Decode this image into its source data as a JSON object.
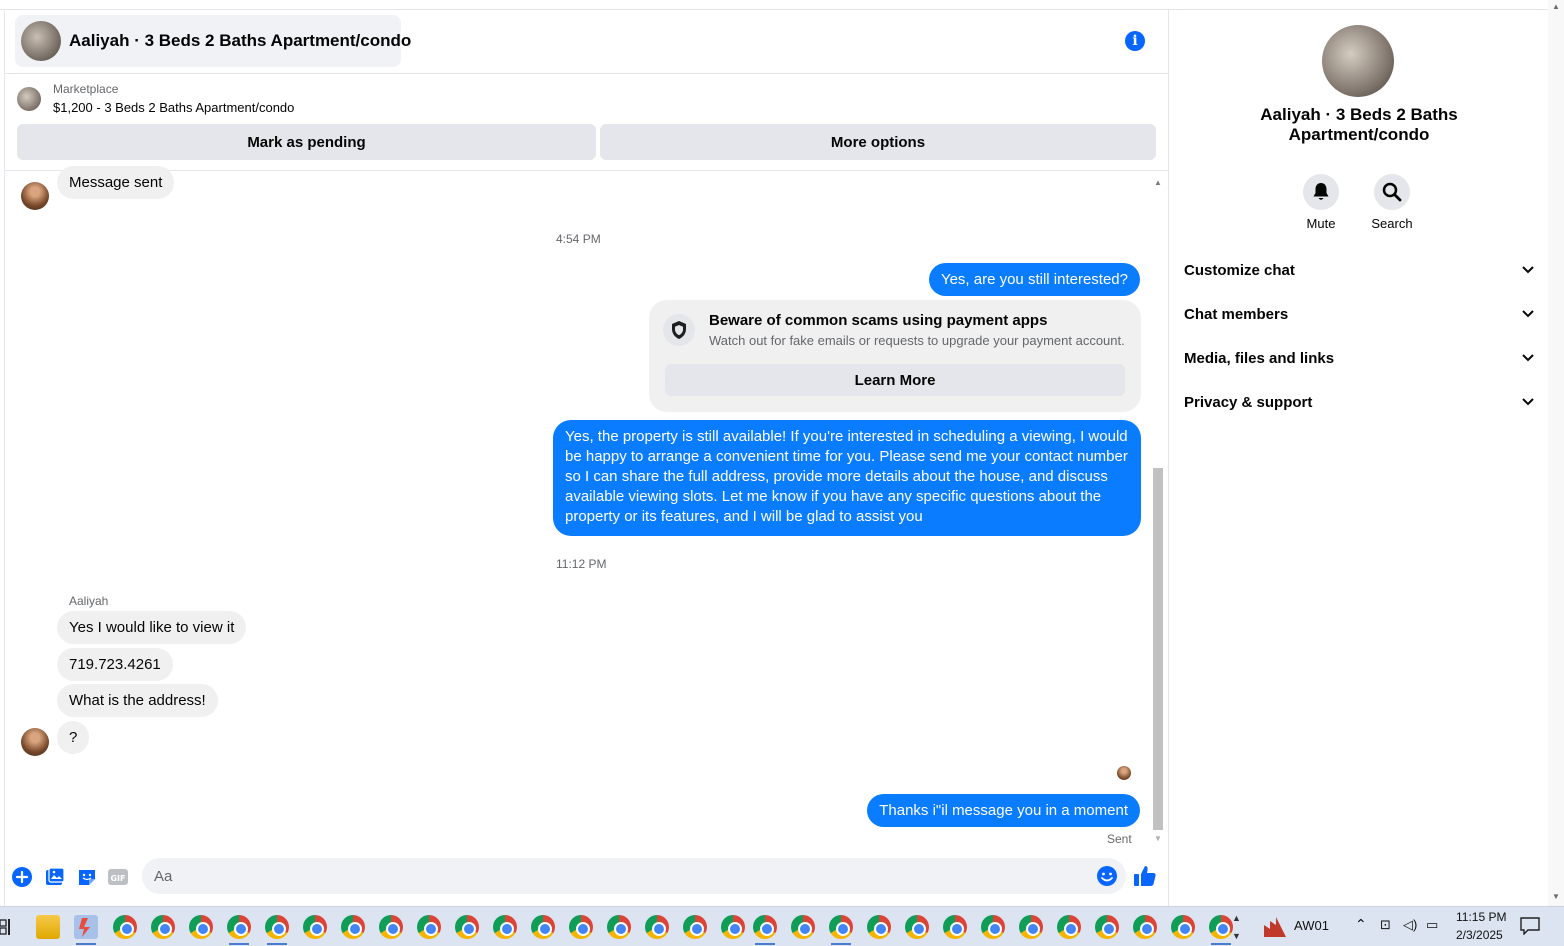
{
  "chat": {
    "header_title": "Aaliyah · 3 Beds 2 Baths Apartment/condo",
    "listing_label": "Marketplace",
    "listing_price": "$1,200 - 3 Beds 2 Baths Apartment/condo",
    "btn_pending": "Mark as pending",
    "btn_more": "More options"
  },
  "messages": {
    "m1": "Message sent",
    "time1": "4:54 PM",
    "m2": "Yes, are you still interested?",
    "scam_title": "Beware of common scams using payment apps",
    "scam_sub": "Watch out for fake emails or requests to upgrade your payment account.",
    "scam_button": "Learn More",
    "long_line1": "Yes, the property is still available! If you're interested in scheduling a viewing, I would",
    "long_line2": "be happy to arrange a convenient time for you. Please send me your contact number",
    "long_line3": "so I can share the full address, provide more details about the house, and discuss",
    "long_line4": "available viewing slots. Let me know if you have any specific questions about the",
    "long_line5": "property or its features, and I will be glad to assist you",
    "time2": "11:12 PM",
    "sender": "Aaliyah",
    "m3": "Yes I would like to view it",
    "m4": "719.723.4261",
    "m5": "What is the address!",
    "m6": "?",
    "m7": "Thanks i\"il message you in a moment",
    "sent": "Sent"
  },
  "composer": {
    "placeholder": "Aa",
    "gif": "GIF"
  },
  "side": {
    "title_line1": "Aaliyah · 3 Beds 2 Baths",
    "title_line2": "Apartment/condo",
    "mute": "Mute",
    "search": "Search",
    "sections": [
      "Customize chat",
      "Chat members",
      "Media, files and links",
      "Privacy & support"
    ]
  },
  "taskbar": {
    "app_label": "AW01",
    "time": "11:15 PM",
    "date": "2/3/2025"
  },
  "colors": {
    "accent": "#0866ff",
    "outgoing": "#0a7cff",
    "incoming": "#f0f0f0"
  }
}
